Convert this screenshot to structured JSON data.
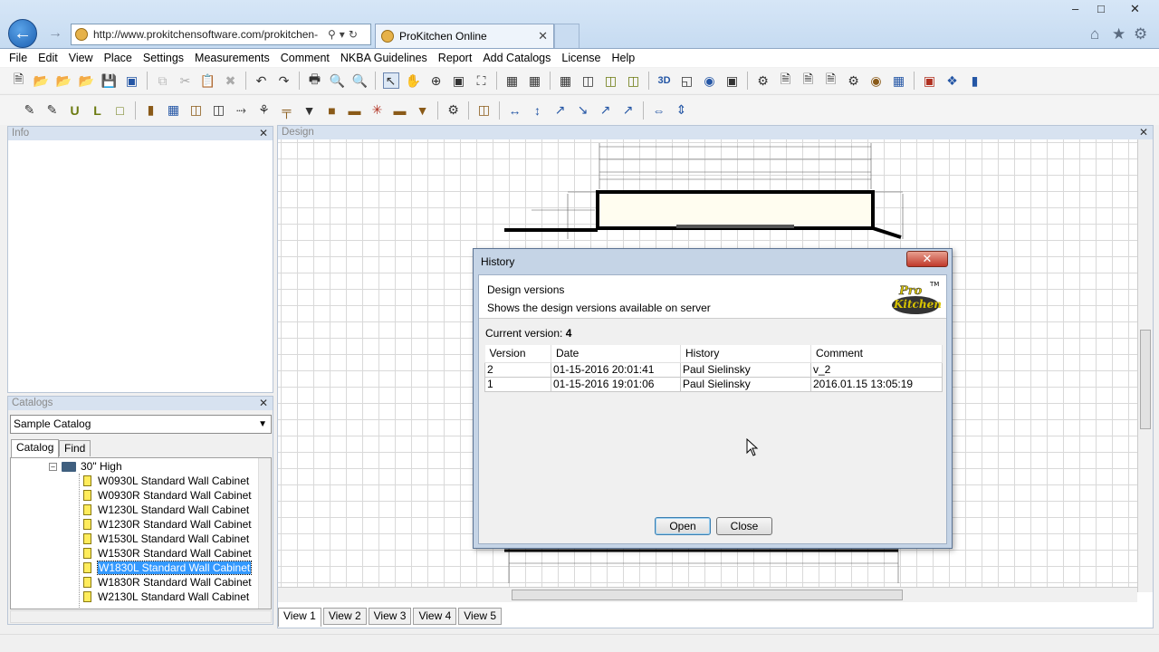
{
  "browser": {
    "url": "http://www.prokitchensoftware.com/prokitchen-",
    "tab_title": "ProKitchen Online",
    "window_controls": [
      "–",
      "□",
      "✕"
    ],
    "right_icons": [
      "home-icon",
      "star-icon",
      "gear-icon"
    ]
  },
  "menu": [
    "File",
    "Edit",
    "View",
    "Place",
    "Settings",
    "Measurements",
    "Comment",
    "NKBA Guidelines",
    "Report",
    "Add Catalogs",
    "License",
    "Help"
  ],
  "panels": {
    "info_title": "Info",
    "catalogs_title": "Catalogs",
    "design_title": "Design"
  },
  "catalogs": {
    "selected_catalog": "Sample Catalog",
    "tabs": [
      "Catalog",
      "Find"
    ],
    "folder": "30\" High",
    "items": [
      "W0930L Standard Wall Cabinet",
      "W0930R Standard Wall Cabinet",
      "W1230L Standard Wall Cabinet",
      "W1230R Standard Wall Cabinet",
      "W1530L Standard Wall Cabinet",
      "W1530R Standard Wall Cabinet",
      "W1830L Standard Wall Cabinet",
      "W1830R Standard Wall Cabinet",
      "W2130L Standard Wall Cabinet"
    ],
    "selected_item": "W1830L Standard Wall Cabinet"
  },
  "view_tabs": [
    "View 1",
    "View 2",
    "View 3",
    "View 4",
    "View 5"
  ],
  "history_dialog": {
    "title": "History",
    "close_glyph": "✕",
    "header_title": "Design versions",
    "header_subtitle": "Shows the design versions available on server",
    "logo_line1": "Pro",
    "logo_line2": "Kitchen",
    "logo_tm": "TM",
    "current_version_label": "Current version:",
    "current_version_value": "4",
    "columns": [
      "Version",
      "Date",
      "History",
      "Comment"
    ],
    "rows": [
      {
        "version": "2",
        "date": "01-15-2016 20:01:41",
        "history": "Paul Sielinsky",
        "comment": "v_2"
      },
      {
        "version": "1",
        "date": "01-15-2016 19:01:06",
        "history": "Paul Sielinsky",
        "comment": "2016.01.15 13:05:19"
      }
    ],
    "open_label": "Open",
    "close_label": "Close"
  }
}
